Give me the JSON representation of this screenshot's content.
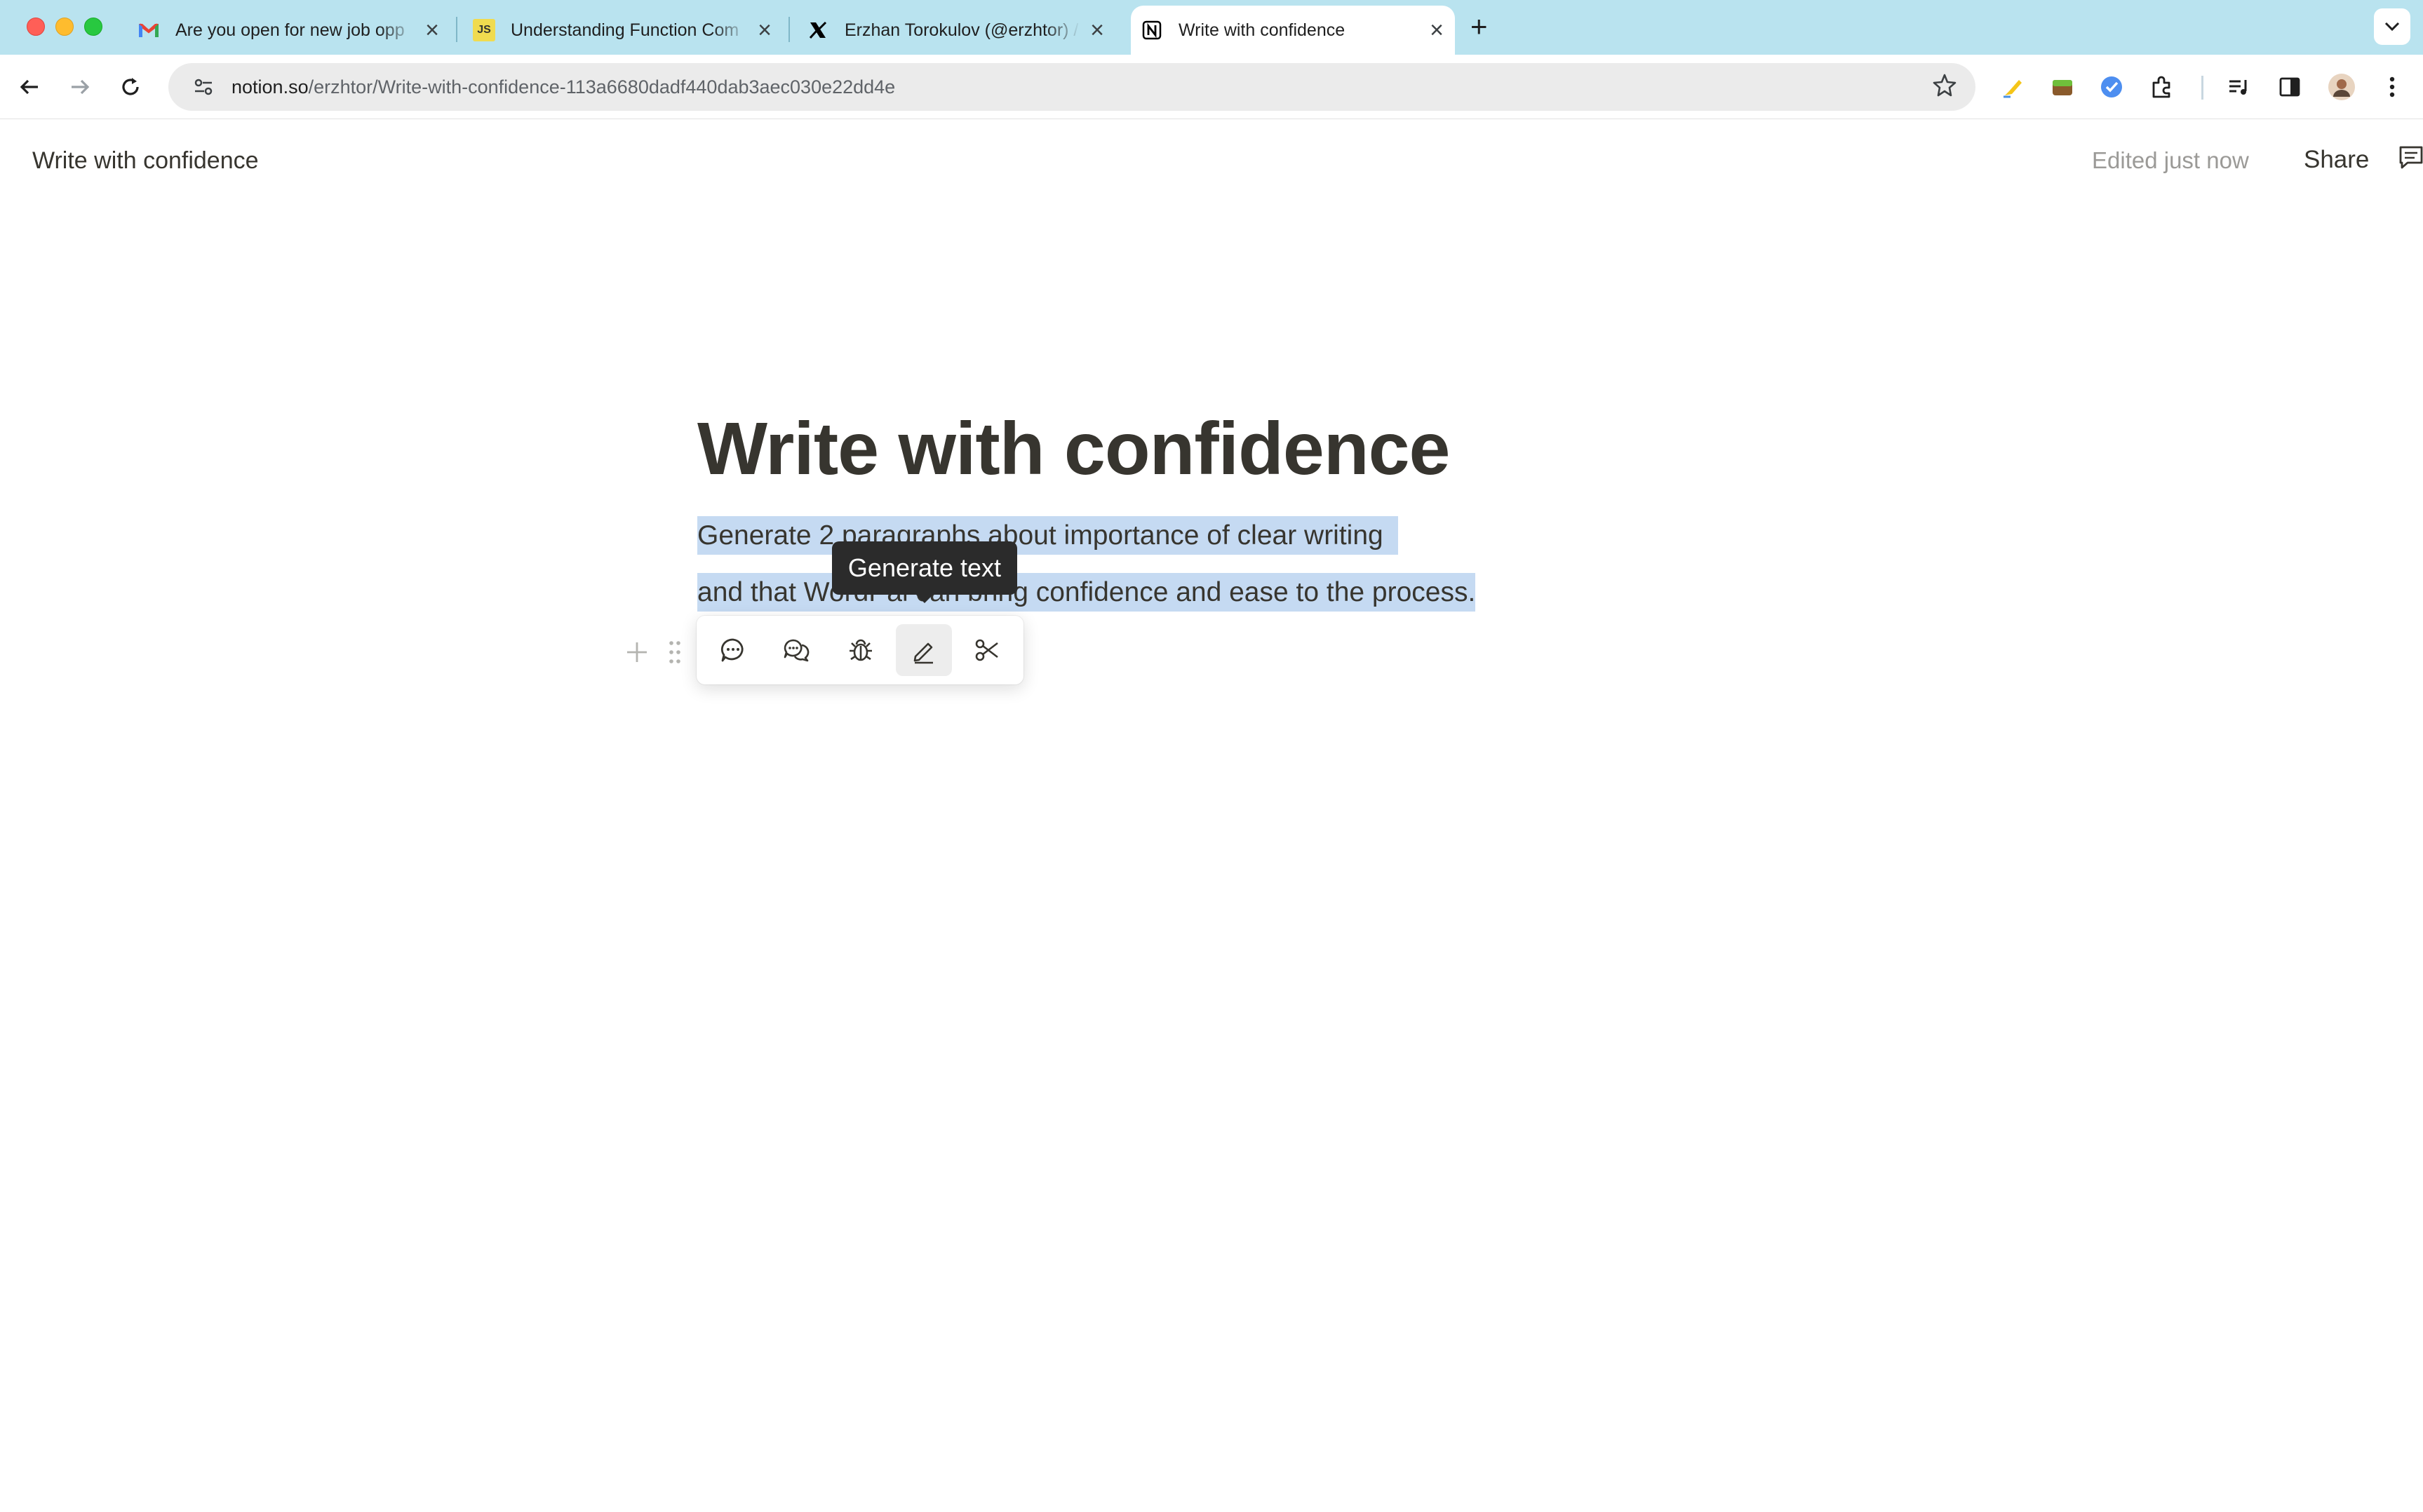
{
  "browser": {
    "tabs": [
      {
        "title": "Are you open for new job opp",
        "favicon": "gmail-icon",
        "active": false
      },
      {
        "title": "Understanding Function Com",
        "favicon": "js-icon",
        "favicon_text": "JS",
        "active": false
      },
      {
        "title": "Erzhan Torokulov (@erzhtor) /",
        "favicon": "x-icon",
        "active": false
      },
      {
        "title": "Write with confidence",
        "favicon": "notion-icon",
        "active": true
      }
    ],
    "url": {
      "host": "notion.so",
      "path": "/erzhtor/Write-with-confidence-113a6680dadf440dab3aec030e22dd4e"
    },
    "colors": {
      "tabstrip": "#b9e3ef",
      "accent": "#1a73e8"
    }
  },
  "notion": {
    "breadcrumb": "Write with confidence",
    "edited_status": "Edited just now",
    "share_label": "Share",
    "page_title": "Write with confidence",
    "paragraph_line1": "Generate 2 paragraphs about importance of clear writing",
    "paragraph_line2": "and that WordPal can bring confidence and ease to the process.",
    "selection_color": "#c5daf2"
  },
  "ai_toolbar": {
    "buttons": [
      {
        "icon": "chat-bubble-icon",
        "active": false
      },
      {
        "icon": "conversation-icon",
        "active": false
      },
      {
        "icon": "bug-icon",
        "active": false
      },
      {
        "icon": "pencil-icon",
        "active": true
      },
      {
        "icon": "scissors-icon",
        "active": false
      }
    ],
    "tooltip": "Generate text"
  }
}
